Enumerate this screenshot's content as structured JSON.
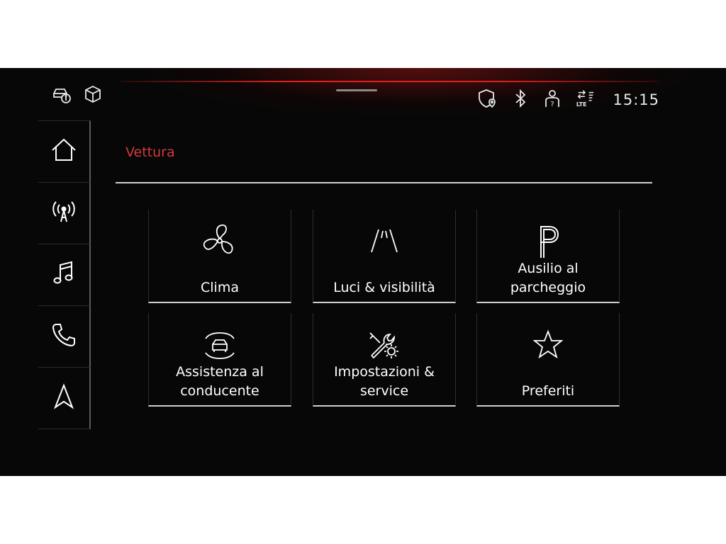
{
  "status_bar": {
    "time": "15:15",
    "icons": [
      "vehicle-info-icon",
      "package-icon",
      "shield-location-icon",
      "bluetooth-icon",
      "user-unknown-icon",
      "lte-signal-icon"
    ],
    "lte_label": "LTE"
  },
  "sidebar": {
    "items": [
      {
        "name": "home",
        "icon": "home-icon"
      },
      {
        "name": "radio",
        "icon": "radio-antenna-icon"
      },
      {
        "name": "media",
        "icon": "music-note-icon"
      },
      {
        "name": "phone",
        "icon": "phone-icon"
      },
      {
        "name": "navigation",
        "icon": "navigation-arrow-icon"
      }
    ]
  },
  "page": {
    "title": "Vettura"
  },
  "tiles": [
    {
      "label": "Clima",
      "icon": "fan-icon"
    },
    {
      "label": "Luci & visibilità",
      "icon": "road-lights-icon"
    },
    {
      "label": "Ausilio al\nparcheggio",
      "icon": "parking-icon"
    },
    {
      "label": "Assistenza al\nconducente",
      "icon": "driver-assist-car-icon"
    },
    {
      "label": "Impostazioni &\nservice",
      "icon": "wrench-gear-icon"
    },
    {
      "label": "Preferiti",
      "icon": "star-icon"
    }
  ],
  "colors": {
    "accent": "#d23a3a",
    "background": "#070707",
    "foreground": "#ffffff"
  }
}
